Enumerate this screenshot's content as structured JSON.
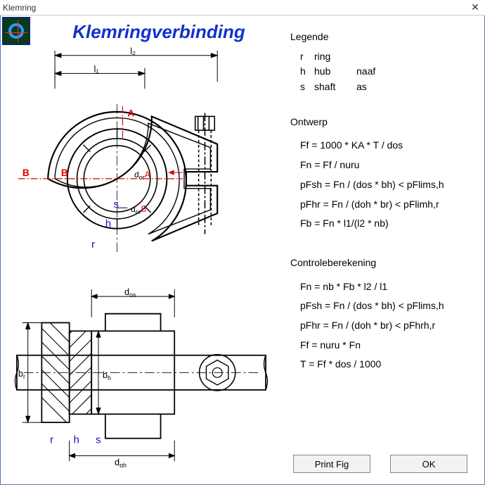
{
  "window": {
    "title": "Klemring",
    "close": "✕"
  },
  "header": {
    "title": "Klemringverbinding"
  },
  "legend": {
    "title": "Legende",
    "rows": [
      {
        "k": "r",
        "a": "ring",
        "b": ""
      },
      {
        "k": "h",
        "a": "hub",
        "b": "naaf"
      },
      {
        "k": "s",
        "a": "shaft",
        "b": "as"
      }
    ]
  },
  "ontwerp": {
    "title": "Ontwerp",
    "lines": [
      "Ff = 1000 * KA * T / dos",
      "Fn = Ff / nuru",
      "pFsh = Fn / (dos * bh)  < pFlims,h",
      "pFhr = Fn / (doh * br)  < pFlimh,r",
      "Fb = Fn * l1/(l2 * nb)"
    ]
  },
  "controle": {
    "title": "Controleberekening",
    "lines": [
      "Fn = nb * Fb * l2 / l1",
      "pFsh = Fn / (dos * bh)  < pFlims,h",
      "pFhr = Fn / (doh * br)  < pFhrh,r",
      "Ff = nuru * Fn",
      "T = Ff * dos / 1000"
    ]
  },
  "buttons": {
    "print": "Print Fig",
    "ok": "OK"
  },
  "diagram": {
    "labels": {
      "l1": "l₁",
      "l2": "l₂",
      "A": "A",
      "Bouter": "B",
      "Binner": "B",
      "dorA": "dorA",
      "dorB": "dorB",
      "s_top": "s",
      "h_top": "h",
      "r_top": "r",
      "dos": "dos",
      "doh": "doh",
      "bh": "bh",
      "br": "br",
      "r_bot": "r",
      "h_bot": "h",
      "s_bot": "s"
    }
  }
}
